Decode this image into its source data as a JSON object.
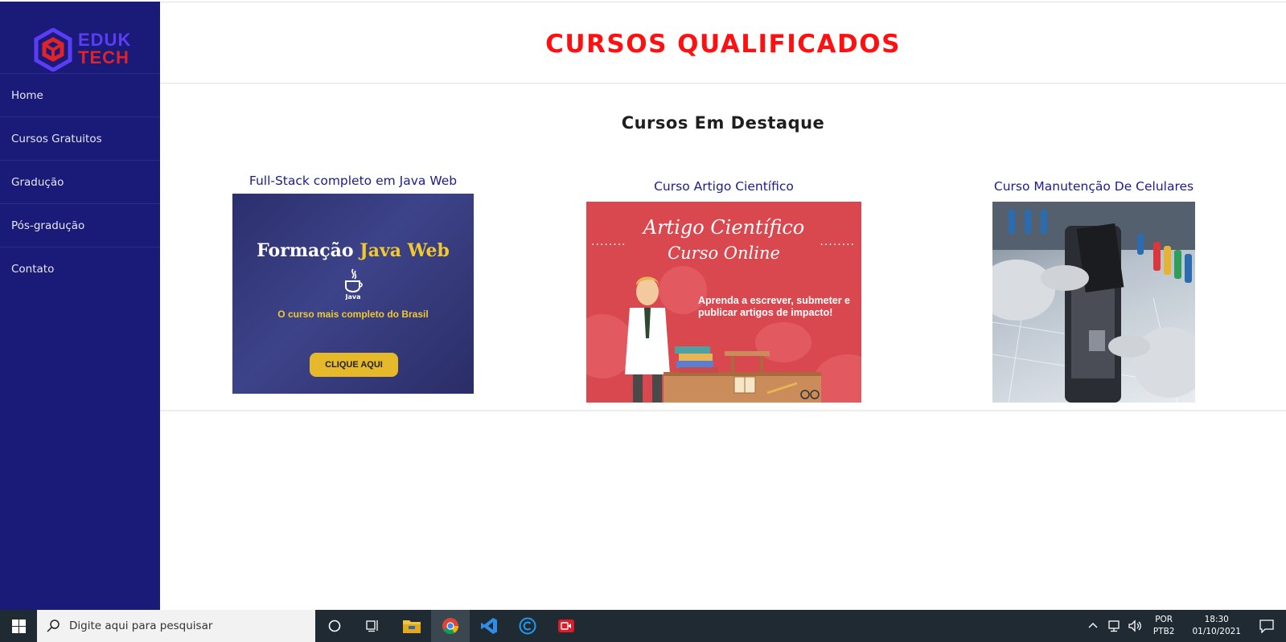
{
  "logo": {
    "line1": "EDUK",
    "line2": "TECH"
  },
  "nav": {
    "items": [
      {
        "label": "Home"
      },
      {
        "label": "Cursos Gratuitos"
      },
      {
        "label": "Gradução"
      },
      {
        "label": "Pós-gradução"
      },
      {
        "label": "Contato"
      }
    ]
  },
  "header": {
    "title": "CURSOS QUALIFICADOS"
  },
  "section": {
    "title": "Cursos Em Destaque"
  },
  "courses": [
    {
      "title": "Full-Stack completo em Java Web",
      "banner_heading_a": "Formação",
      "banner_heading_b": "Java Web",
      "banner_logo": "Java",
      "banner_sub": "O curso mais completo do Brasil",
      "banner_button": "CLIQUE AQUI"
    },
    {
      "title": "Curso Artigo Científico",
      "banner_line1": "Artigo Científico",
      "banner_line2": "Curso Online",
      "banner_desc": "Aprenda a escrever, submeter e publicar artigos de impacto!"
    },
    {
      "title": "Curso Manutenção De Celulares"
    }
  ],
  "taskbar": {
    "search_placeholder": "Digite aqui para pesquisar",
    "lang_line1": "POR",
    "lang_line2": "PTB2",
    "time": "18:30",
    "date": "01/10/2021"
  },
  "colors": {
    "sidebar": "#1a1a78",
    "title_red": "#ff1010",
    "course_title_blue": "#1c1c8c",
    "taskbar": "#1f2a33"
  }
}
